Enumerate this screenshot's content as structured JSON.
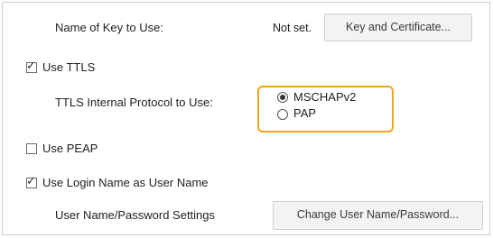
{
  "key_row": {
    "label": "Name of Key to Use:",
    "value": "Not set.",
    "button_label": "Key and Certificate..."
  },
  "use_ttls": {
    "label": "Use TTLS",
    "checked": true
  },
  "ttls_protocol": {
    "label": "TTLS Internal Protocol to Use:",
    "options": [
      {
        "label": "MSCHAPv2",
        "selected": true
      },
      {
        "label": "PAP",
        "selected": false
      }
    ],
    "highlight_color": "#f2a51a"
  },
  "use_peap": {
    "label": "Use PEAP",
    "checked": false
  },
  "use_login_name": {
    "label": "Use Login Name as User Name",
    "checked": true
  },
  "user_password_row": {
    "label": "User Name/Password Settings",
    "button_label": "Change User Name/Password..."
  }
}
